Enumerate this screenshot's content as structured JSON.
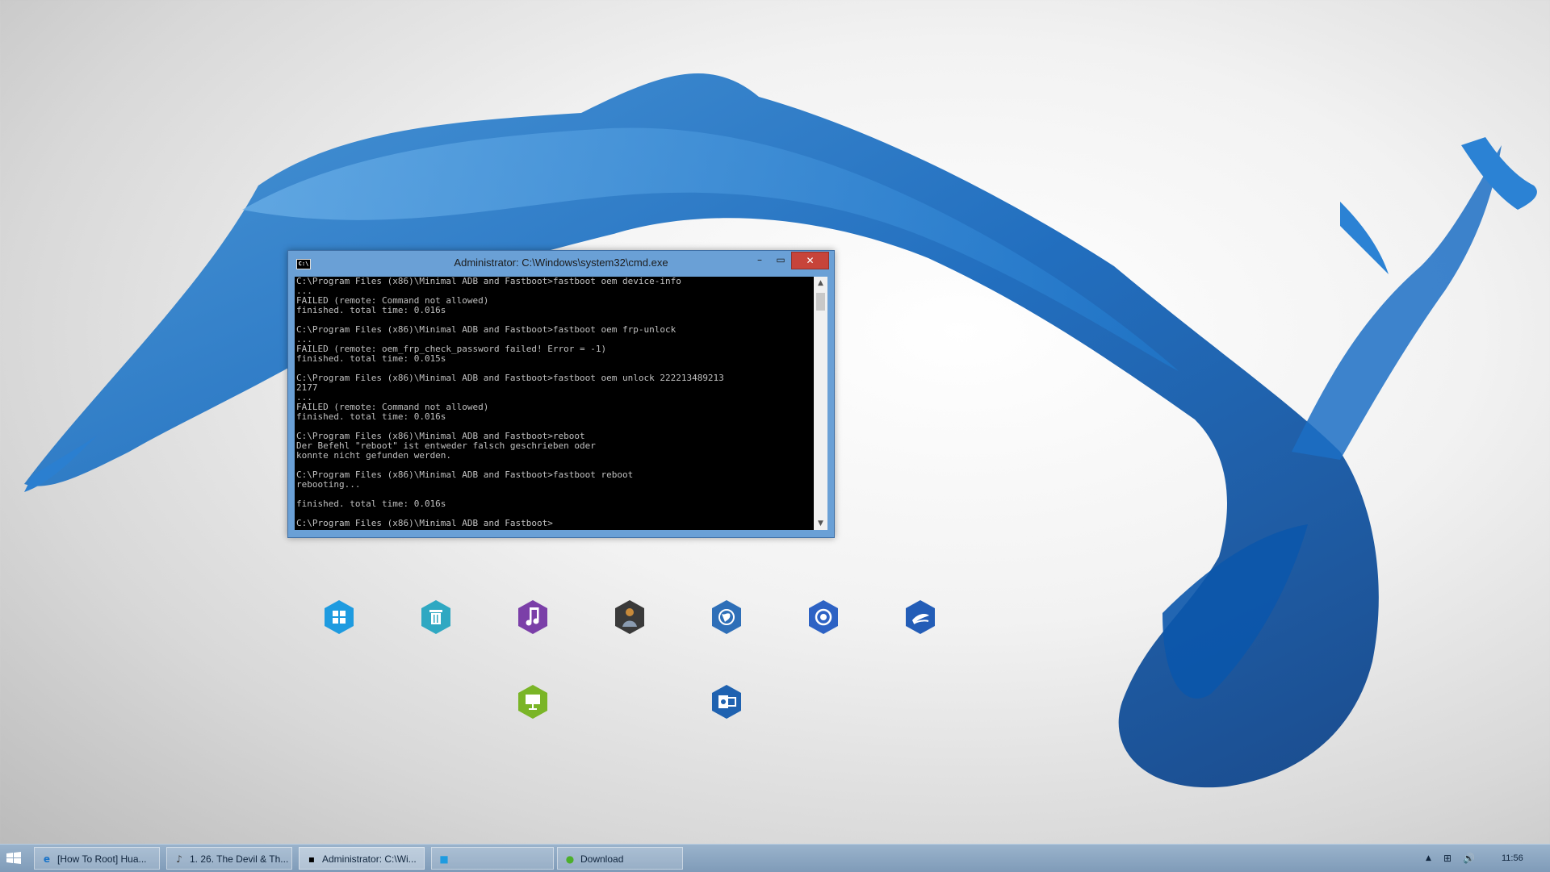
{
  "cmd_window": {
    "title": "Administrator: C:\\Windows\\system32\\cmd.exe",
    "icon_text": "C:\\",
    "minimize_glyph": "–",
    "maximize_glyph": "▭",
    "close_glyph": "✕",
    "lines": [
      "C:\\Program Files (x86)\\Minimal ADB and Fastboot>fastboot oem device-info",
      "...",
      "FAILED (remote: Command not allowed)",
      "finished. total time: 0.016s",
      "",
      "C:\\Program Files (x86)\\Minimal ADB and Fastboot>fastboot oem frp-unlock",
      "...",
      "FAILED (remote: oem_frp_check_password failed! Error = -1)",
      "finished. total time: 0.015s",
      "",
      "C:\\Program Files (x86)\\Minimal ADB and Fastboot>fastboot oem unlock 222213489213",
      "2177",
      "...",
      "FAILED (remote: Command not allowed)",
      "finished. total time: 0.016s",
      "",
      "C:\\Program Files (x86)\\Minimal ADB and Fastboot>reboot",
      "Der Befehl \"reboot\" ist entweder falsch geschrieben oder",
      "konnte nicht gefunden werden.",
      "",
      "C:\\Program Files (x86)\\Minimal ADB and Fastboot>fastboot reboot",
      "rebooting...",
      "",
      "finished. total time: 0.016s",
      "",
      "C:\\Program Files (x86)\\Minimal ADB and Fastboot>"
    ]
  },
  "desktop_icons": [
    {
      "name": "windows-store-icon",
      "color": "#1e9be0"
    },
    {
      "name": "recycle-bin-icon",
      "color": "#2fa8c2"
    },
    {
      "name": "music-icon",
      "color": "#7b3fa8"
    },
    {
      "name": "game-character-icon",
      "color": "#3a3a3a"
    },
    {
      "name": "globe-network-icon",
      "color": "#2e6fb8"
    },
    {
      "name": "chrome-browser-icon",
      "color": "#2d62c4"
    },
    {
      "name": "earth-app-icon",
      "color": "#235db7"
    },
    {
      "name": "presentation-icon",
      "color": "#7ab527"
    },
    {
      "name": "outlook-icon",
      "color": "#1f62b0"
    }
  ],
  "taskbar": {
    "items": [
      {
        "label": "[How To Root] Hua...",
        "icon": "ie-icon",
        "glyph": "e",
        "active": false
      },
      {
        "label": "1. 26. The Devil & Th...",
        "icon": "media-player-icon",
        "glyph": "♪",
        "active": false
      },
      {
        "label": "Administrator: C:\\Wi...",
        "icon": "cmd-icon",
        "glyph": "▪",
        "active": true
      },
      {
        "label": "",
        "icon": "app-icon",
        "glyph": "■",
        "active": false
      },
      {
        "label": "Download",
        "icon": "download-icon",
        "glyph": "●",
        "active": false
      }
    ],
    "tray": {
      "chevron": "▲",
      "network_glyph": "⊞",
      "volume_glyph": "🔊",
      "clock": "11:56"
    }
  }
}
